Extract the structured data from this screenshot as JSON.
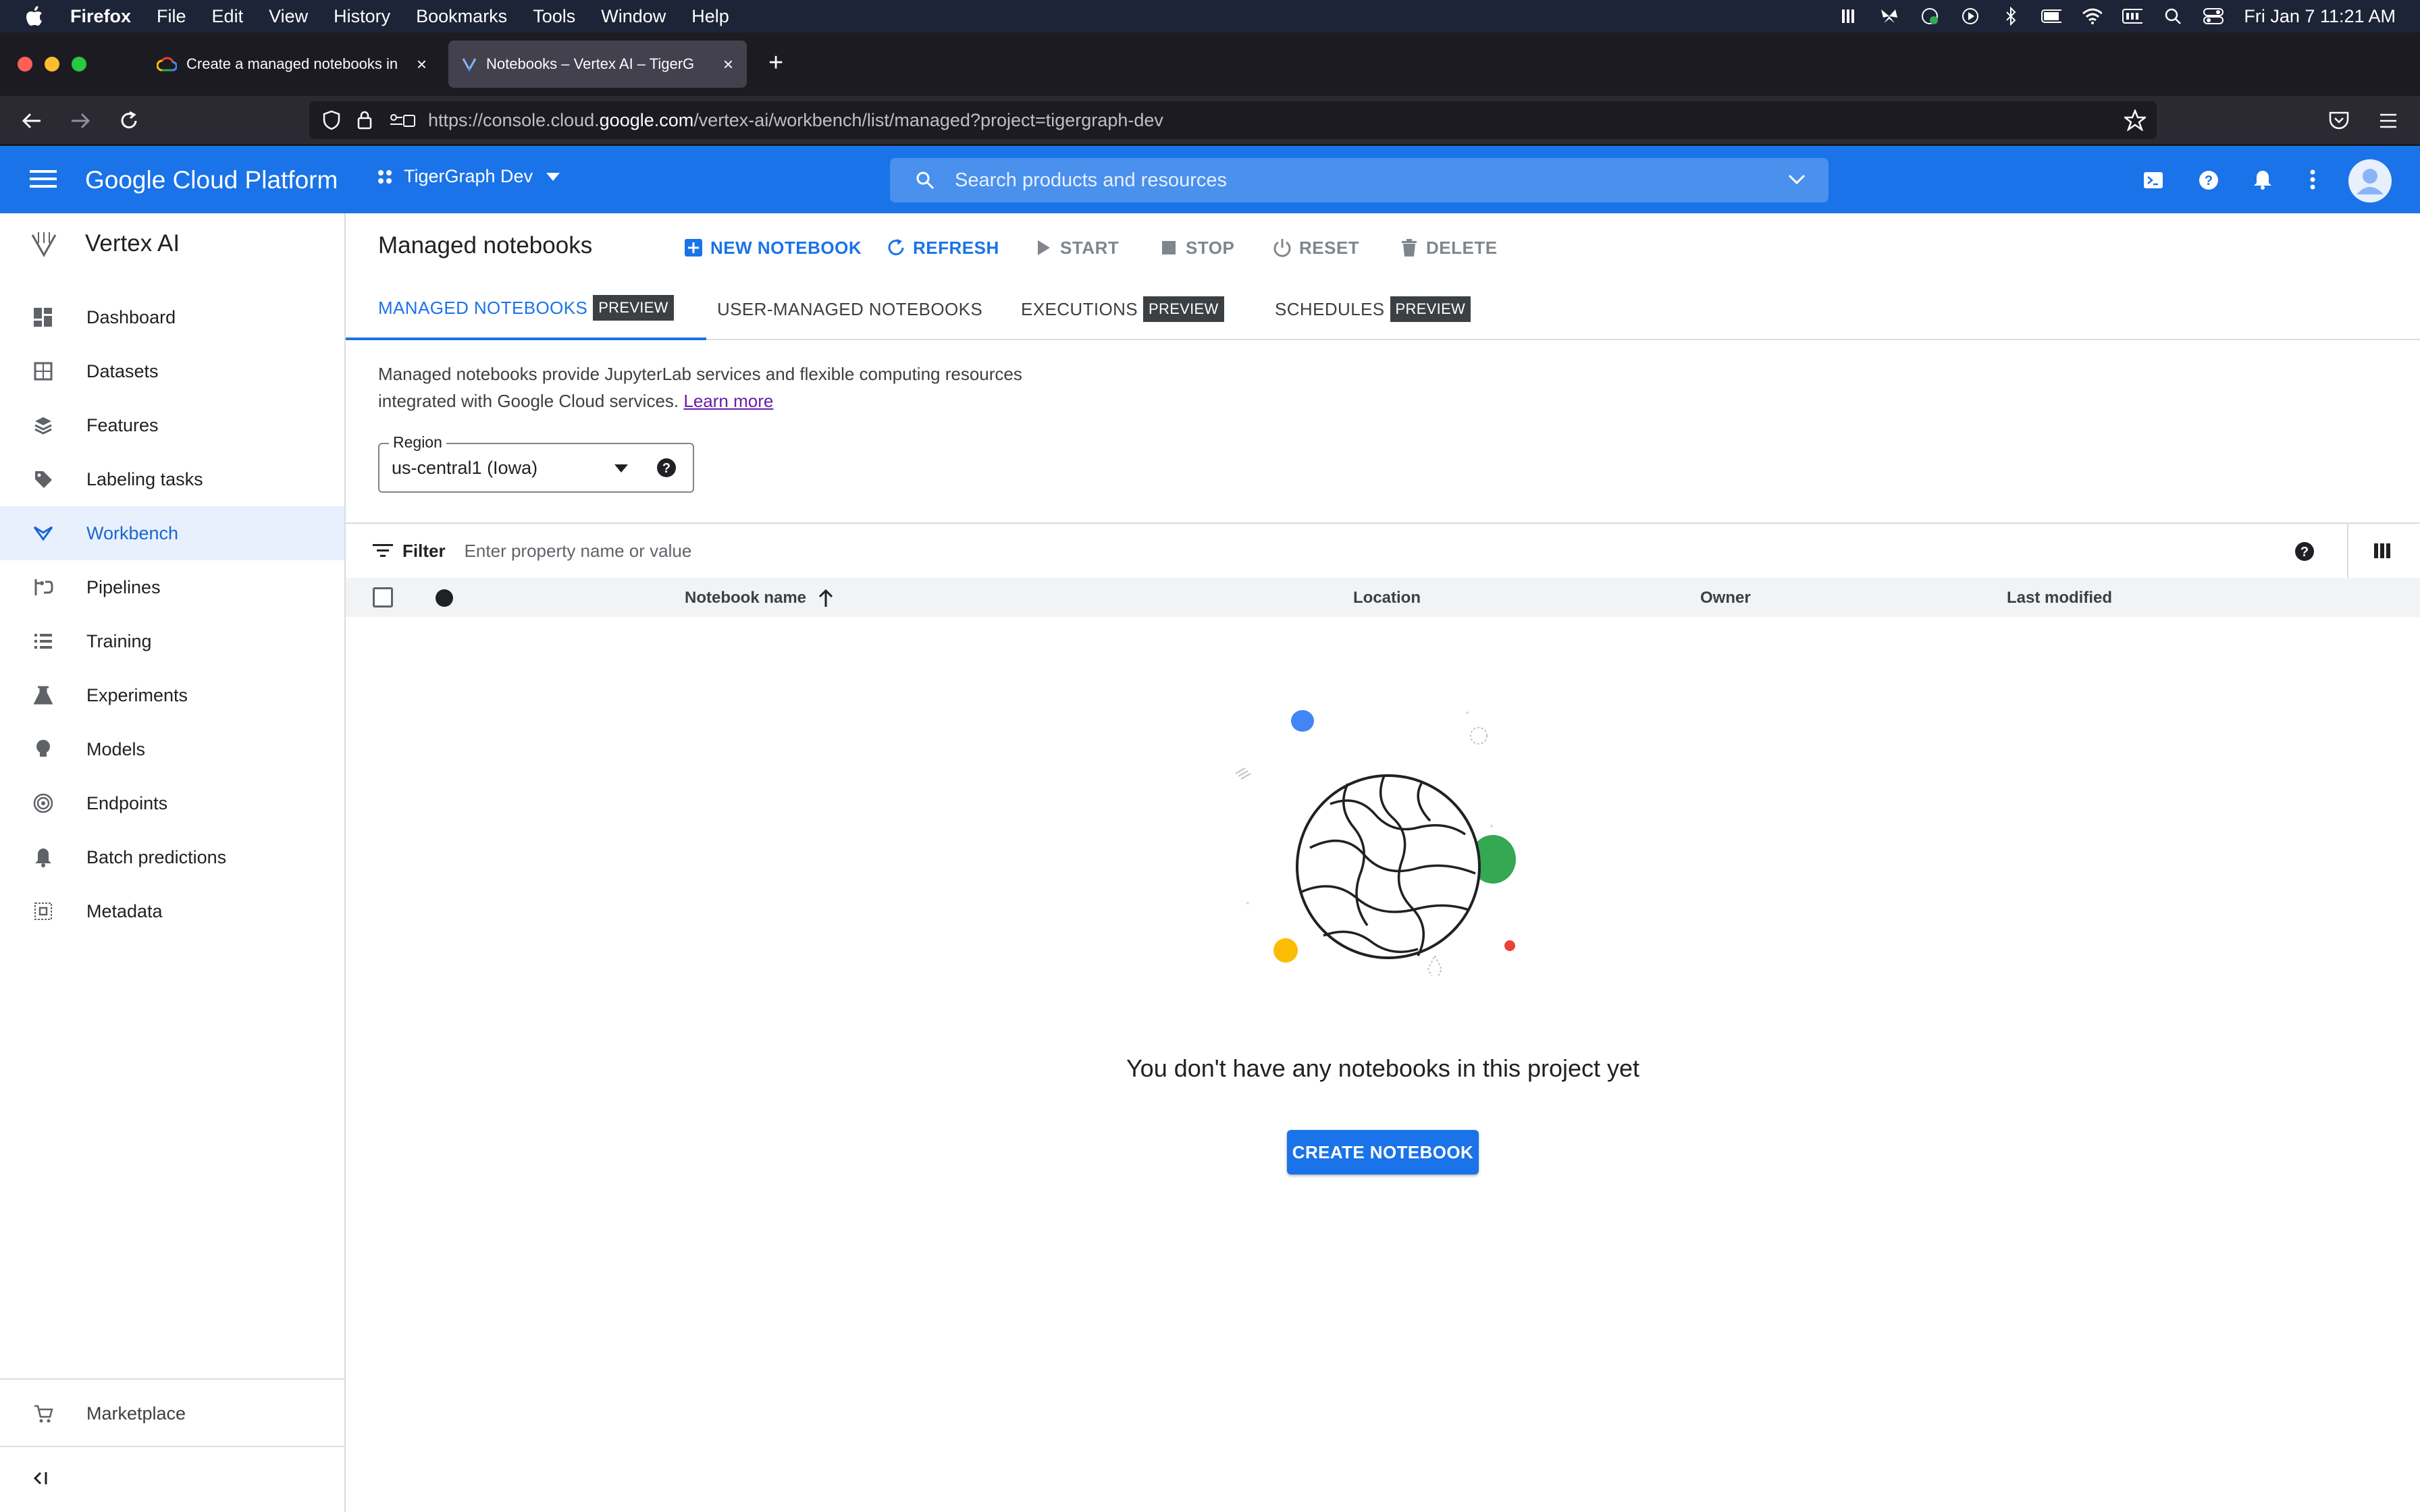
{
  "menubar": {
    "app": "Firefox",
    "items": [
      "File",
      "Edit",
      "View",
      "History",
      "Bookmarks",
      "Tools",
      "Window",
      "Help"
    ],
    "datetime": "Fri Jan 7  11:21 AM"
  },
  "browser": {
    "tabs": [
      {
        "title": "Create a managed notebooks in",
        "icon": "google-cloud-icon"
      },
      {
        "title": "Notebooks – Vertex AI – TigerG",
        "icon": "vertex-icon"
      }
    ],
    "url_prefix": "https://console.cloud.",
    "url_domain": "google.com",
    "url_suffix": "/vertex-ai/workbench/list/managed?project=tigergraph-dev"
  },
  "gcp": {
    "brand": "Google Cloud Platform",
    "project": "TigerGraph Dev",
    "search_placeholder": "Search products and resources"
  },
  "sidebar": {
    "product": "Vertex AI",
    "items": [
      {
        "label": "Dashboard",
        "icon": "dashboard-icon"
      },
      {
        "label": "Datasets",
        "icon": "datasets-icon"
      },
      {
        "label": "Features",
        "icon": "features-icon"
      },
      {
        "label": "Labeling tasks",
        "icon": "tag-icon"
      },
      {
        "label": "Workbench",
        "icon": "workbench-icon",
        "active": true
      },
      {
        "label": "Pipelines",
        "icon": "pipelines-icon"
      },
      {
        "label": "Training",
        "icon": "training-icon"
      },
      {
        "label": "Experiments",
        "icon": "flask-icon"
      },
      {
        "label": "Models",
        "icon": "lightbulb-icon"
      },
      {
        "label": "Endpoints",
        "icon": "endpoints-icon"
      },
      {
        "label": "Batch predictions",
        "icon": "bell-icon"
      },
      {
        "label": "Metadata",
        "icon": "metadata-icon"
      }
    ],
    "marketplace": "Marketplace"
  },
  "main": {
    "title": "Managed notebooks",
    "actions": {
      "new_notebook": "NEW NOTEBOOK",
      "refresh": "REFRESH",
      "start": "START",
      "stop": "STOP",
      "reset": "RESET",
      "delete": "DELETE"
    },
    "tabs": [
      {
        "label": "MANAGED NOTEBOOKS",
        "badge": "PREVIEW",
        "active": true
      },
      {
        "label": "USER-MANAGED NOTEBOOKS",
        "badge": ""
      },
      {
        "label": "EXECUTIONS",
        "badge": "PREVIEW"
      },
      {
        "label": "SCHEDULES",
        "badge": "PREVIEW"
      }
    ],
    "description_line1": "Managed notebooks provide JupyterLab services and flexible computing resources",
    "description_line2": "integrated with Google Cloud services.",
    "learn_more": "Learn more",
    "region_label": "Region",
    "region_value": "us-central1 (Iowa)",
    "filter_label": "Filter",
    "filter_placeholder": "Enter property name or value",
    "columns": {
      "name": "Notebook name",
      "location": "Location",
      "owner": "Owner",
      "last_modified": "Last modified"
    },
    "empty_message": "You don't have any notebooks in this project yet",
    "create_button": "CREATE NOTEBOOK"
  },
  "colors": {
    "brand_blue": "#1a73e8",
    "menubar_bg": "#1e2437",
    "browser_bg": "#1c1b22"
  }
}
